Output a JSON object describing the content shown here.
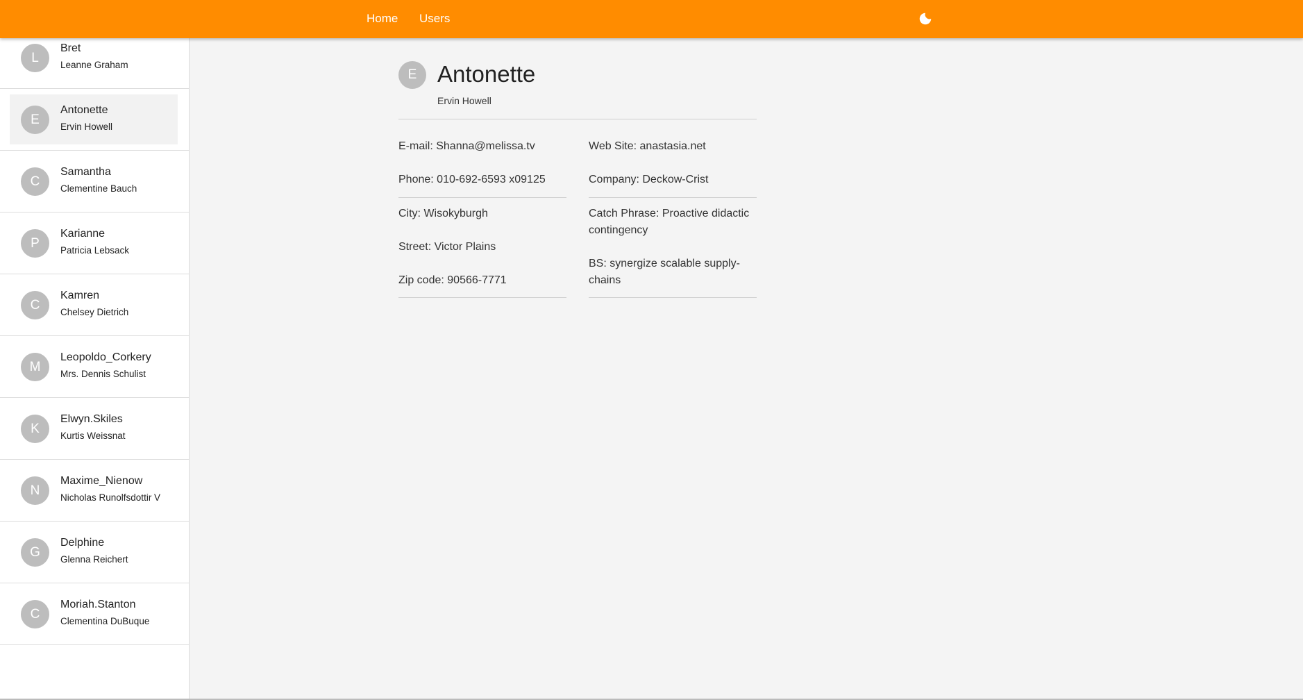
{
  "header": {
    "nav": [
      "Home",
      "Users"
    ],
    "theme_icon": "moon-icon",
    "color": "#ff8c00"
  },
  "sidebar": {
    "users": [
      {
        "initial": "L",
        "username": "Bret",
        "name": "Leanne Graham",
        "selected": false
      },
      {
        "initial": "E",
        "username": "Antonette",
        "name": "Ervin Howell",
        "selected": true
      },
      {
        "initial": "C",
        "username": "Samantha",
        "name": "Clementine Bauch",
        "selected": false
      },
      {
        "initial": "P",
        "username": "Karianne",
        "name": "Patricia Lebsack",
        "selected": false
      },
      {
        "initial": "C",
        "username": "Kamren",
        "name": "Chelsey Dietrich",
        "selected": false
      },
      {
        "initial": "M",
        "username": "Leopoldo_Corkery",
        "name": "Mrs. Dennis Schulist",
        "selected": false
      },
      {
        "initial": "K",
        "username": "Elwyn.Skiles",
        "name": "Kurtis Weissnat",
        "selected": false
      },
      {
        "initial": "N",
        "username": "Maxime_Nienow",
        "name": "Nicholas Runolfsdottir V",
        "selected": false
      },
      {
        "initial": "G",
        "username": "Delphine",
        "name": "Glenna Reichert",
        "selected": false
      },
      {
        "initial": "C",
        "username": "Moriah.Stanton",
        "name": "Clementina DuBuque",
        "selected": false
      }
    ]
  },
  "detail": {
    "initial": "E",
    "username": "Antonette",
    "name": "Ervin Howell",
    "email_label": "E-mail:",
    "email": "Shanna@melissa.tv",
    "phone_label": "Phone:",
    "phone": "010-692-6593 x09125",
    "city_label": "City:",
    "city": "Wisokyburgh",
    "street_label": "Street:",
    "street": "Victor Plains",
    "zip_label": "Zip code:",
    "zip": "90566-7771",
    "website_label": "Web Site:",
    "website": "anastasia.net",
    "company_label": "Company:",
    "company": "Deckow-Crist",
    "catchphrase_label": "Catch Phrase:",
    "catchphrase": "Proactive didactic contingency",
    "bs_label": "BS:",
    "bs": "synergize scalable supply-chains"
  }
}
